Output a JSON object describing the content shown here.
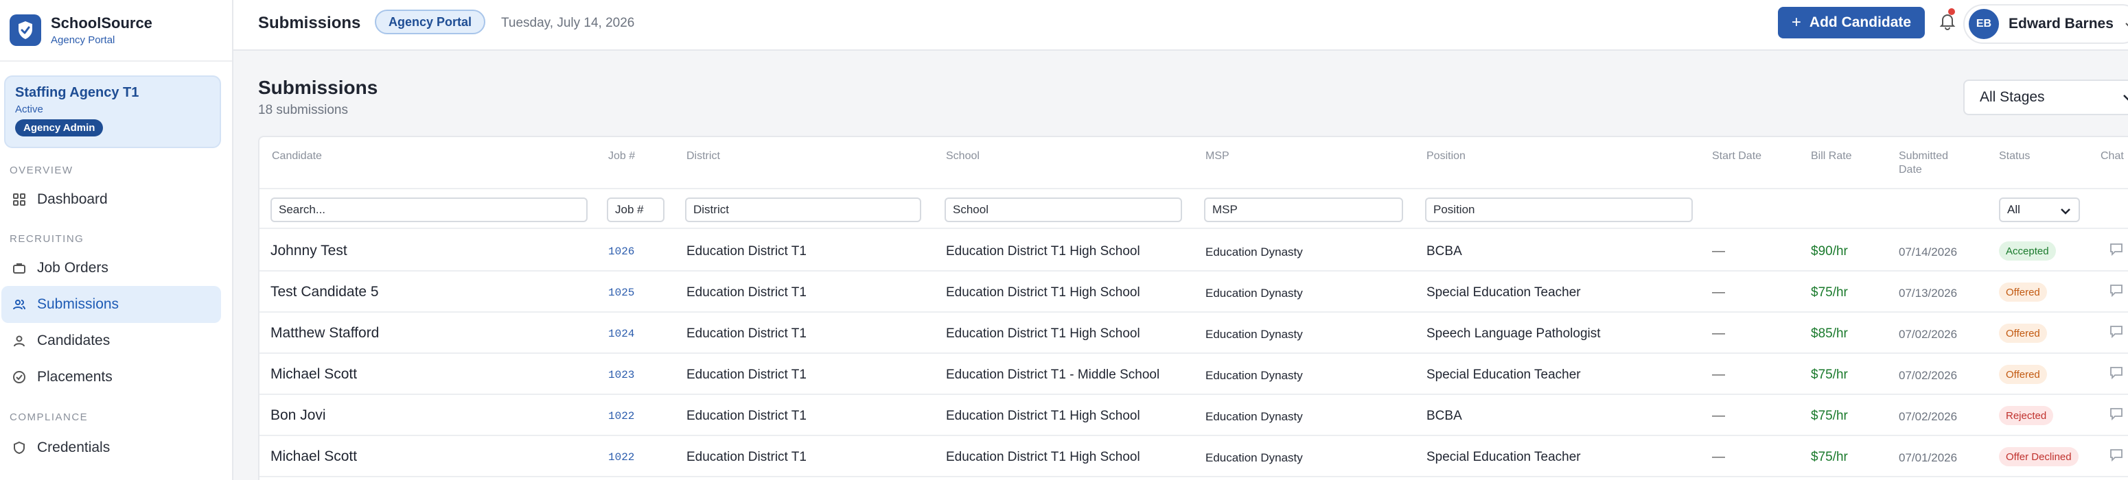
{
  "brand": {
    "name": "SchoolSource",
    "subtitle": "Agency Portal"
  },
  "agency": {
    "name": "Staffing Agency T1",
    "status": "Active",
    "role": "Agency Admin"
  },
  "nav": {
    "overview_label": "OVERVIEW",
    "recruiting_label": "RECRUITING",
    "compliance_label": "COMPLIANCE",
    "dashboard": "Dashboard",
    "job_orders": "Job Orders",
    "submissions": "Submissions",
    "candidates": "Candidates",
    "placements": "Placements",
    "credentials": "Credentials"
  },
  "header": {
    "title": "Submissions",
    "portal_pill": "Agency Portal",
    "date": "Tuesday, July 14, 2026",
    "add_button": "Add Candidate",
    "user_initials": "EB",
    "user_name": "Edward Barnes"
  },
  "main": {
    "title": "Submissions",
    "count": "18 submissions",
    "stage_filter": "All Stages"
  },
  "table": {
    "headers": {
      "candidate": "Candidate",
      "job": "Job #",
      "district": "District",
      "school": "School",
      "msp": "MSP",
      "position": "Position",
      "start_date": "Start Date",
      "bill_rate": "Bill Rate",
      "submitted_line1": "Submitted",
      "submitted_line2": "Date",
      "status": "Status",
      "chat": "Chat"
    },
    "filters": {
      "candidate": "Search...",
      "job": "Job #",
      "district": "District",
      "school": "School",
      "msp": "MSP",
      "position": "Position",
      "status": "All"
    },
    "rows": [
      {
        "candidate": "Johnny Test",
        "job": "1026",
        "district": "Education District T1",
        "school": "Education District T1 High School",
        "msp": "Education Dynasty",
        "position": "BCBA",
        "start": "—",
        "rate": "$90/hr",
        "submitted": "07/14/2026",
        "status": "Accepted"
      },
      {
        "candidate": "Test Candidate 5",
        "job": "1025",
        "district": "Education District T1",
        "school": "Education District T1 High School",
        "msp": "Education Dynasty",
        "position": "Special Education Teacher",
        "start": "—",
        "rate": "$75/hr",
        "submitted": "07/13/2026",
        "status": "Offered"
      },
      {
        "candidate": "Matthew Stafford",
        "job": "1024",
        "district": "Education District T1",
        "school": "Education District T1 High School",
        "msp": "Education Dynasty",
        "position": "Speech Language Pathologist",
        "start": "—",
        "rate": "$85/hr",
        "submitted": "07/02/2026",
        "status": "Offered"
      },
      {
        "candidate": "Michael Scott",
        "job": "1023",
        "district": "Education District T1",
        "school": "Education District T1 - Middle School",
        "msp": "Education Dynasty",
        "position": "Special Education Teacher",
        "start": "—",
        "rate": "$75/hr",
        "submitted": "07/02/2026",
        "status": "Offered"
      },
      {
        "candidate": "Bon Jovi",
        "job": "1022",
        "district": "Education District T1",
        "school": "Education District T1 High School",
        "msp": "Education Dynasty",
        "position": "BCBA",
        "start": "—",
        "rate": "$75/hr",
        "submitted": "07/02/2026",
        "status": "Rejected"
      },
      {
        "candidate": "Michael Scott",
        "job": "1022",
        "district": "Education District T1",
        "school": "Education District T1 High School",
        "msp": "Education Dynasty",
        "position": "Special Education Teacher",
        "start": "—",
        "rate": "$75/hr",
        "submitted": "07/01/2026",
        "status": "Offer Declined"
      }
    ]
  },
  "status_colors": {
    "Accepted": {
      "bg": "#e2f4e5",
      "fg": "#1a7a2c"
    },
    "Offered": {
      "bg": "#fdeee0",
      "fg": "#c25a12"
    },
    "Rejected": {
      "bg": "#fde6e6",
      "fg": "#c0322e"
    },
    "Offer Declined": {
      "bg": "#fde6e6",
      "fg": "#c0322e"
    }
  },
  "colors": {
    "accent": "#2b5cad",
    "rate": "#1a7a2c"
  }
}
